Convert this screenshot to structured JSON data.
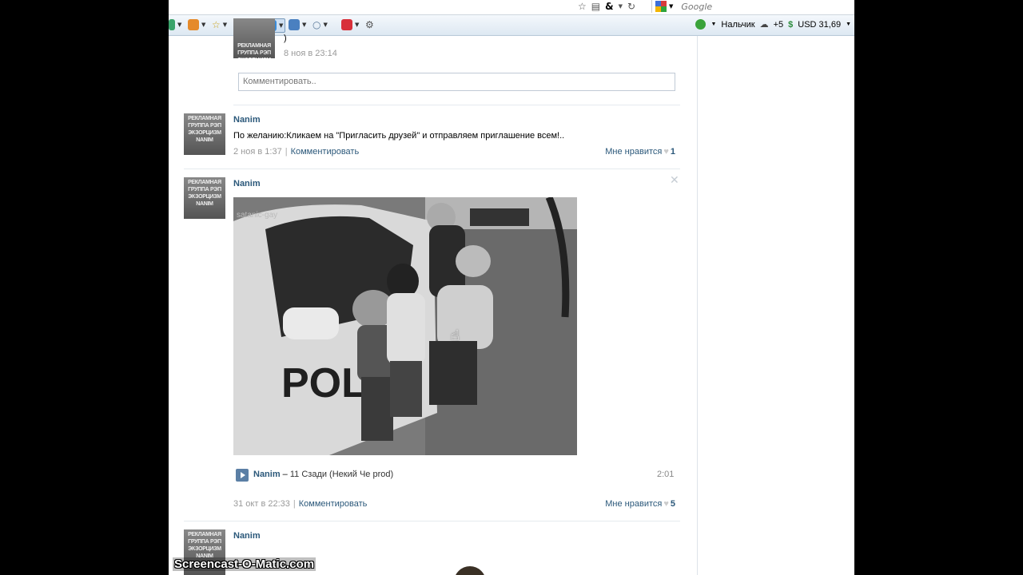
{
  "browser": {
    "search_placeholder": "Google",
    "weather": "Нальчик",
    "temperature": "+5",
    "currency": "USD 31,69"
  },
  "posts": [
    {
      "partial_text": ")",
      "date": "8 ноя в 23:14",
      "comment_placeholder": "Комментировать.."
    },
    {
      "author": "Nanim",
      "text": "По желанию:Кликаем на \"Пригласить друзей\" и отправляем приглашение всем!..",
      "date": "2 ноя в 1:37",
      "comment_label": "Комментировать",
      "like_label": "Мне нравится",
      "like_count": "1"
    },
    {
      "author": "Nanim",
      "photo_watermark": "satanic-gay",
      "photo_text": "POLI",
      "audio": {
        "artist": "Nanim",
        "dash": " – ",
        "title": "11 Сзади (Некий Че prod)",
        "duration": "2:01"
      },
      "date": "31 окт в 22:33",
      "comment_label": "Комментировать",
      "like_label": "Мне нравится",
      "like_count": "5"
    },
    {
      "author": "Nanim"
    }
  ],
  "avatar_text": "РЕКЛАМНАЯ ГРУППА РЭП ЭКЗОРЦИЗМ NANIM",
  "screencast_watermark": "Screencast-O-Matic.com"
}
